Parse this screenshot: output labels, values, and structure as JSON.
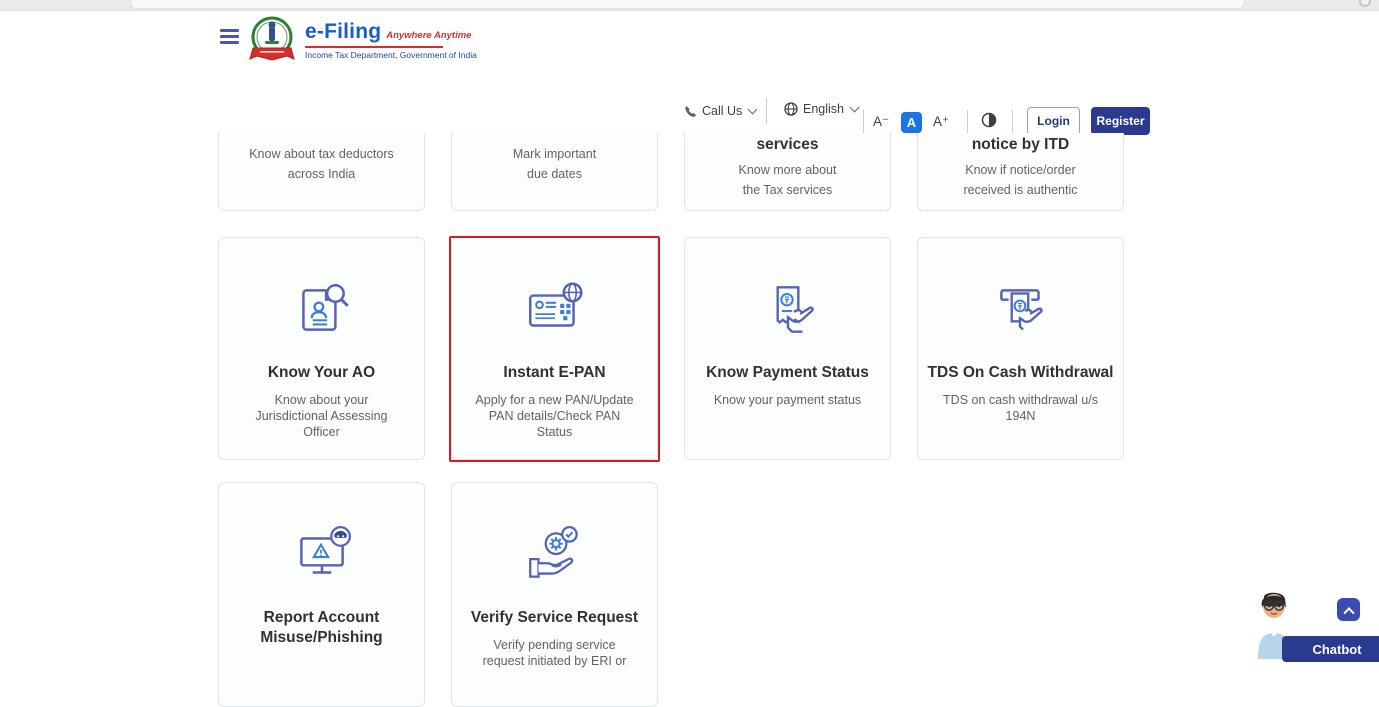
{
  "header": {
    "logo_title": "e-Filing",
    "logo_tagline": "Anywhere Anytime",
    "logo_subtitle": "Income Tax Department, Government of India",
    "hamburger_icon": "hamburger-menu-icon",
    "emblem_icon": "income-tax-dept-emblem"
  },
  "topbar": {
    "call_us_label": "Call Us",
    "call_us_icon": "phone-icon",
    "language_label": "English",
    "language_icon": "globe-icon",
    "font_decrease_label": "A⁻",
    "font_normal_label": "A",
    "font_increase_label": "A⁺",
    "contrast_icon": "contrast-half-circle-icon",
    "login_label": "Login",
    "register_label": "Register"
  },
  "cards": {
    "row1": [
      {
        "title": "",
        "subtitle": "Know about tax deductors\nacross India"
      },
      {
        "title": "",
        "subtitle": "Mark important\ndue dates"
      },
      {
        "title": "services",
        "subtitle": "Know more about\nthe Tax services"
      },
      {
        "title": "notice by ITD",
        "subtitle": "Know if notice/order\nreceived is authentic"
      }
    ],
    "row2": [
      {
        "title": "Know Your AO",
        "subtitle": "Know about your\nJurisdictional Assessing\nOfficer",
        "icon": "document-person-search-icon",
        "highlighted": false
      },
      {
        "title": "Instant E-PAN",
        "subtitle": "Apply for a new PAN/Update\nPAN details/Check PAN\nStatus",
        "icon": "epan-card-globe-icon",
        "highlighted": true
      },
      {
        "title": "Know Payment Status",
        "subtitle": "Know your payment status",
        "icon": "payment-receipt-hand-icon",
        "highlighted": false
      },
      {
        "title": "TDS On Cash Withdrawal",
        "subtitle": "TDS on cash withdrawal u/s\n194N",
        "icon": "atm-cash-withdrawal-icon",
        "highlighted": false
      }
    ],
    "row3": [
      {
        "title": "Report Account\nMisuse/Phishing",
        "subtitle": "",
        "icon": "monitor-phishing-alert-icon",
        "highlighted": false
      },
      {
        "title": "Verify Service Request",
        "subtitle": "Verify pending service\nrequest initiated by ERI or",
        "icon": "hand-gear-check-icon",
        "highlighted": false
      }
    ]
  },
  "chatbot": {
    "label": "Chatbot",
    "avatar_icon": "chatbot-mascot-avatar",
    "scroll_top_icon": "chevron-up-icon"
  },
  "colors": {
    "accent_navy": "#2a3b8f",
    "active_blue": "#1a73e8",
    "highlight_red": "#d01d25",
    "logo_blue": "#1a5dc8",
    "logo_red": "#d32f2f",
    "icon_stroke": "#5563b5",
    "icon_accent": "#3c7fd9"
  }
}
